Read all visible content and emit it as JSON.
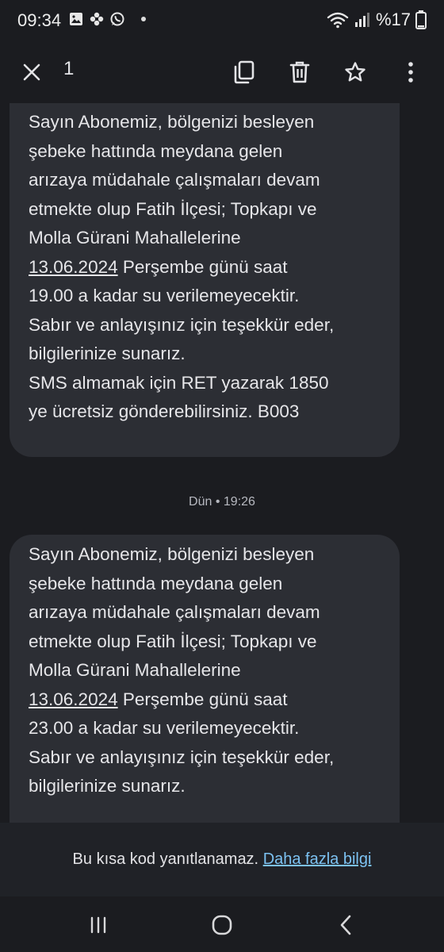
{
  "status_bar": {
    "time": "09:34",
    "battery": "%17",
    "icons": [
      "image-icon",
      "flower-icon",
      "whatsapp-icon",
      "notification-dot",
      "wifi-icon",
      "signal-icon"
    ]
  },
  "app_bar": {
    "selected_count": "1",
    "icons": [
      "close-icon",
      "copy-icon",
      "delete-icon",
      "star-icon",
      "more-options-icon"
    ]
  },
  "messages": [
    {
      "text_before_link": "Sayın Abonemiz, bölgenizi besleyen\nşebeke hattında meydana gelen\narızaya müdahale çalışmaları devam\netmekte olup Fatih İlçesi; Topkapı ve\nMolla Gürani Mahallelerine\n",
      "link_date": "13.06.2024",
      "text_after_link": " Perşembe günü saat\n19.00 a kadar su verilemeyecektir.\nSabır ve anlayışınız için teşekkür eder,\nbilgilerinize sunarız.\nSMS almamak için RET yazarak 1850\nye ücretsiz gönderebilirsiniz. B003"
    },
    {
      "text_before_link": "Sayın Abonemiz, bölgenizi besleyen\nşebeke hattında meydana gelen\narızaya müdahale çalışmaları devam\netmekte olup Fatih İlçesi; Topkapı ve\nMolla Gürani Mahallelerine\n",
      "link_date": "13.06.2024",
      "text_after_link": " Perşembe günü saat\n23.00 a kadar su verilemeyecektir.\nSabır ve anlayışınız için teşekkür eder,\nbilgilerinize sunarız."
    }
  ],
  "timestamp": "Dün • 19:26",
  "footer": {
    "notice": "Bu kısa kod yanıtlanamaz.",
    "link": "Daha fazla bilgi"
  },
  "nav_bar": {
    "icons": [
      "recents-icon",
      "home-icon",
      "back-icon"
    ]
  },
  "colors": {
    "background": "#1b1c20",
    "bubble": "#2c2e34",
    "link": "#7cc2f2"
  }
}
